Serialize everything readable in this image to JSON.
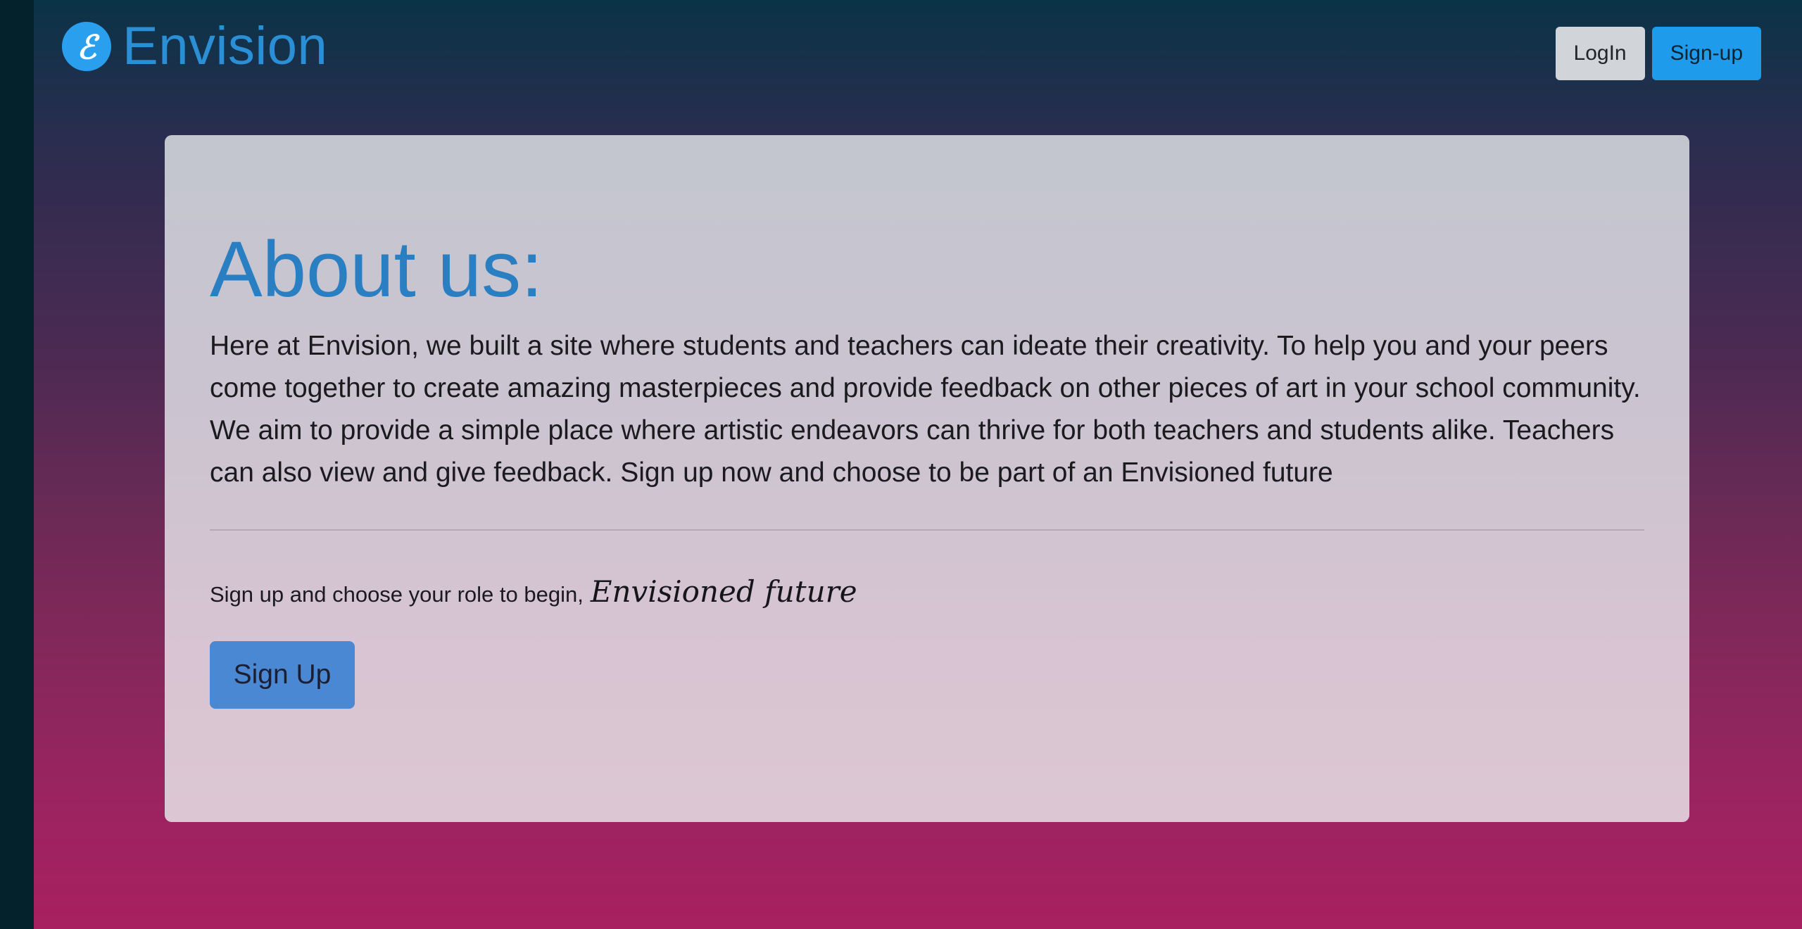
{
  "brand": {
    "name": "Envision",
    "logo_icon": "envision-e-logo-icon",
    "logo_glyph": "ℰ",
    "color": "#2b8fd6"
  },
  "navbar": {
    "login_label": "LogIn",
    "signup_label": "Sign-up"
  },
  "about": {
    "title": "About us:",
    "body": "Here at Envision, we built a site where students and teachers can ideate their creativity. To help you and your peers come together to create amazing masterpieces and provide feedback on other pieces of art in your school community. We aim to provide a simple place where artistic endeavors can thrive for both teachers and students alike. Teachers can also view and give feedback. Sign up now and choose to be part of an Envisioned future",
    "prompt": "Sign up and choose your role to begin,",
    "prompt_emphasis": "Envisioned future",
    "cta_label": "Sign Up"
  },
  "colors": {
    "accent_blue": "#1e9bea",
    "title_blue": "#2a7fc2",
    "cta_blue": "#4a88d3",
    "login_gray": "#d1d5da",
    "gradient_top": "#0a3347",
    "gradient_bottom": "#a8205f"
  }
}
